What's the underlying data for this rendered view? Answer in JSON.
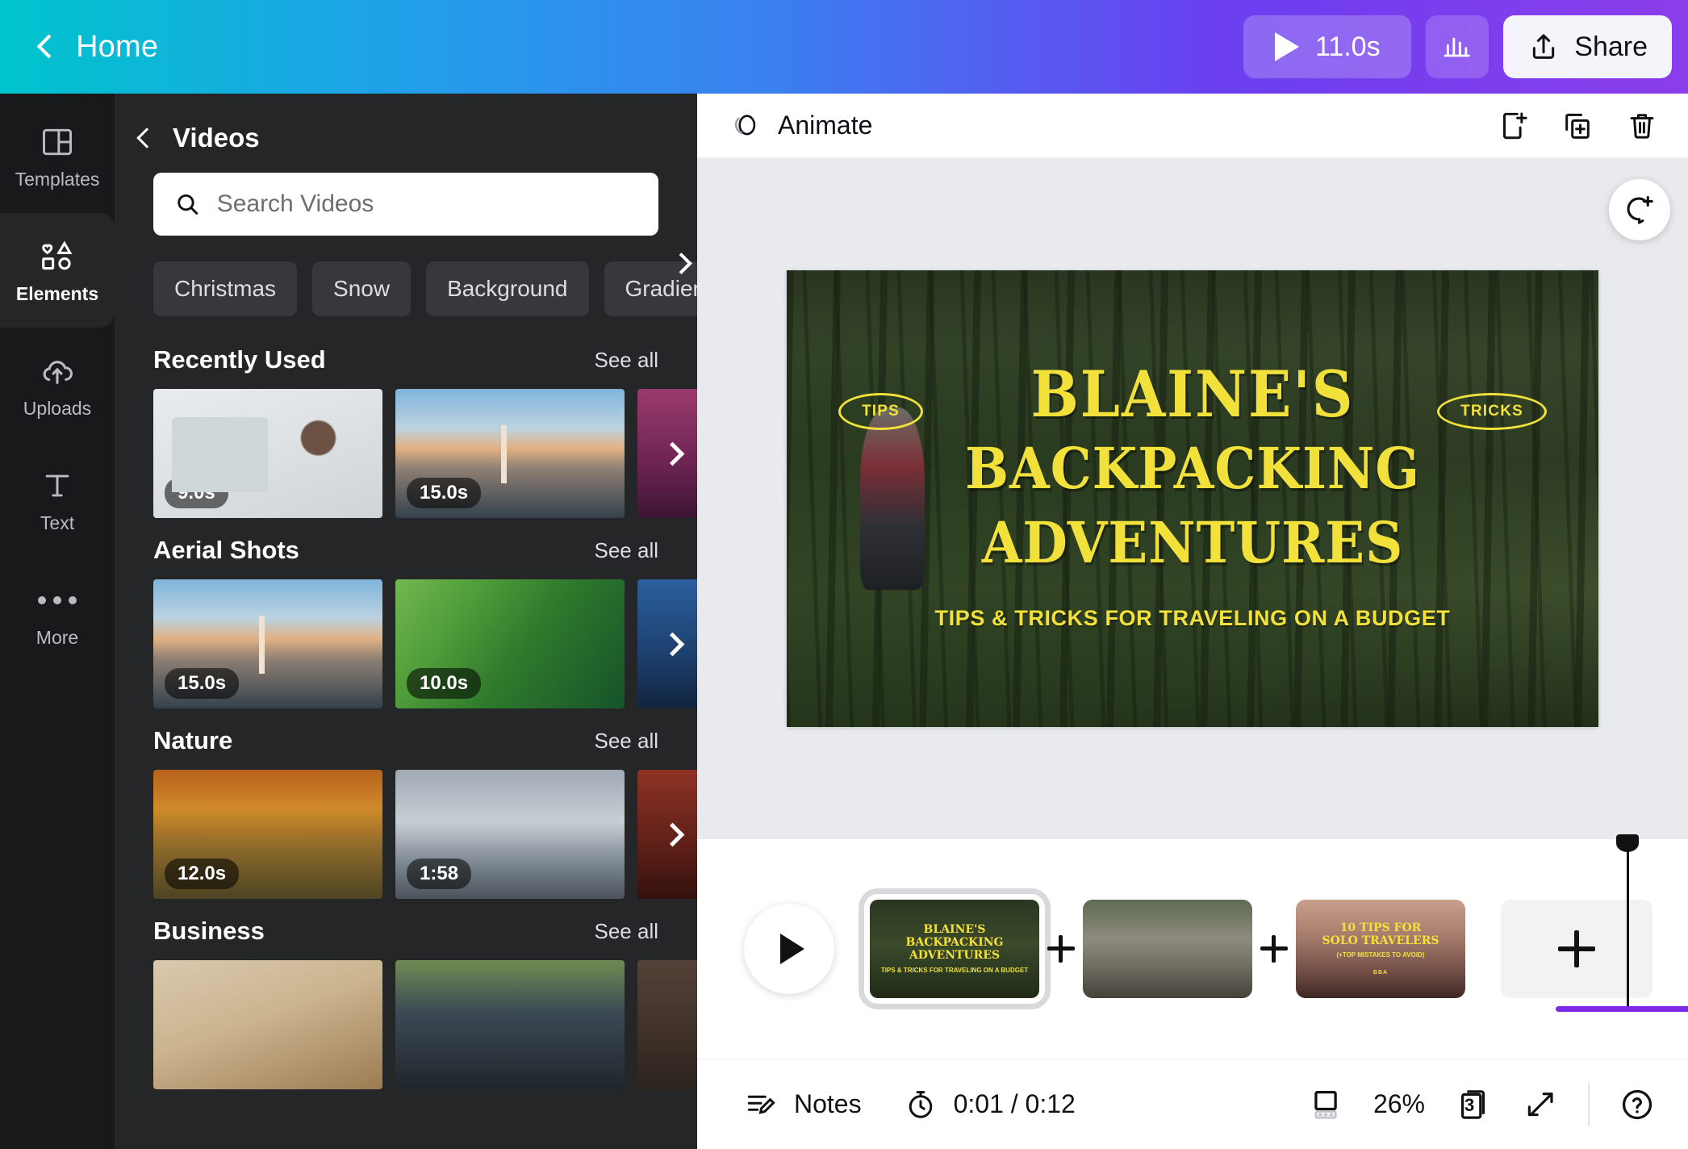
{
  "topbar": {
    "back_label": "Home",
    "duration_label": "11.0s",
    "share_label": "Share",
    "icons": {
      "back": "chevron-left-icon",
      "play": "play-icon",
      "audio": "audio-bars-icon",
      "share": "share-upload-icon"
    }
  },
  "rail": {
    "items": [
      {
        "label": "Templates",
        "icon": "templates-grid-icon",
        "active": false
      },
      {
        "label": "Elements",
        "icon": "elements-shapes-icon",
        "active": true
      },
      {
        "label": "Uploads",
        "icon": "cloud-upload-icon",
        "active": false
      },
      {
        "label": "Text",
        "icon": "text-t-icon",
        "active": false
      },
      {
        "label": "More",
        "icon": "more-dots-icon",
        "active": false
      }
    ]
  },
  "panel": {
    "title": "Videos",
    "back_icon": "chevron-left-icon",
    "search": {
      "placeholder": "Search Videos",
      "value": "",
      "icon": "search-icon"
    },
    "chips": [
      "Christmas",
      "Snow",
      "Background",
      "Gradient"
    ],
    "chips_next_icon": "chevron-right-icon",
    "see_all_label": "See all",
    "sections": [
      {
        "title": "Recently Used",
        "items": [
          {
            "duration": "9.0s",
            "art": "t-desk"
          },
          {
            "duration": "15.0s",
            "art": "t-bridge"
          },
          {
            "duration": "",
            "art": "t-purple"
          }
        ]
      },
      {
        "title": "Aerial Shots",
        "items": [
          {
            "duration": "15.0s",
            "art": "t-bridge"
          },
          {
            "duration": "10.0s",
            "art": "t-field"
          },
          {
            "duration": "",
            "art": "t-blue"
          }
        ]
      },
      {
        "title": "Nature",
        "items": [
          {
            "duration": "12.0s",
            "art": "t-autumn"
          },
          {
            "duration": "1:58",
            "art": "t-fog"
          },
          {
            "duration": "",
            "art": "t-red"
          }
        ]
      },
      {
        "title": "Business",
        "items": [
          {
            "duration": "",
            "art": "t-notes"
          },
          {
            "duration": "",
            "art": "t-suits"
          },
          {
            "duration": "",
            "art": "t-dark"
          }
        ]
      }
    ]
  },
  "stage": {
    "animate_label": "Animate",
    "animate_icon": "animate-circles-icon",
    "header_icons": [
      "add-page-icon",
      "duplicate-page-icon",
      "delete-page-icon"
    ],
    "comment_icon": "add-comment-icon",
    "collapse_icon": "chevron-left-icon",
    "design": {
      "badge_left": "TIPS",
      "badge_right": "TRICKS",
      "title_line1": "BLAINE'S",
      "title_line2": "BACKPACKING",
      "title_line3": "ADVENTURES",
      "subtitle": "TIPS & TRICKS FOR TRAVELING ON A BUDGET",
      "accent_color": "#f2e13a"
    }
  },
  "timeline": {
    "play_icon": "play-icon",
    "add_icon": "plus-icon",
    "clips": [
      {
        "selected": true,
        "art": "clip-1",
        "title_a": "BLAINE'S\nBACKPACKING\nADVENTURES",
        "title_b": "TIPS & TRICKS FOR TRAVELING ON A BUDGET",
        "title_c": ""
      },
      {
        "selected": false,
        "art": "clip-2",
        "title_a": "",
        "title_b": "",
        "title_c": ""
      },
      {
        "selected": false,
        "art": "clip-3",
        "title_a": "10 TIPS FOR\nSOLO TRAVELERS",
        "title_b": "(+TOP MISTAKES TO AVOID)",
        "title_c": "BBA"
      }
    ],
    "progress_color": "#7d2ae8"
  },
  "statusbar": {
    "notes_label": "Notes",
    "notes_icon": "notes-icon",
    "timer_icon": "timer-icon",
    "time_label": "0:01 / 0:12",
    "layout_icon": "layout-icon",
    "zoom_label": "26%",
    "page_count": "3",
    "pages_icon": "pages-icon",
    "fullscreen_icon": "expand-icon",
    "help_icon": "help-question-icon"
  }
}
